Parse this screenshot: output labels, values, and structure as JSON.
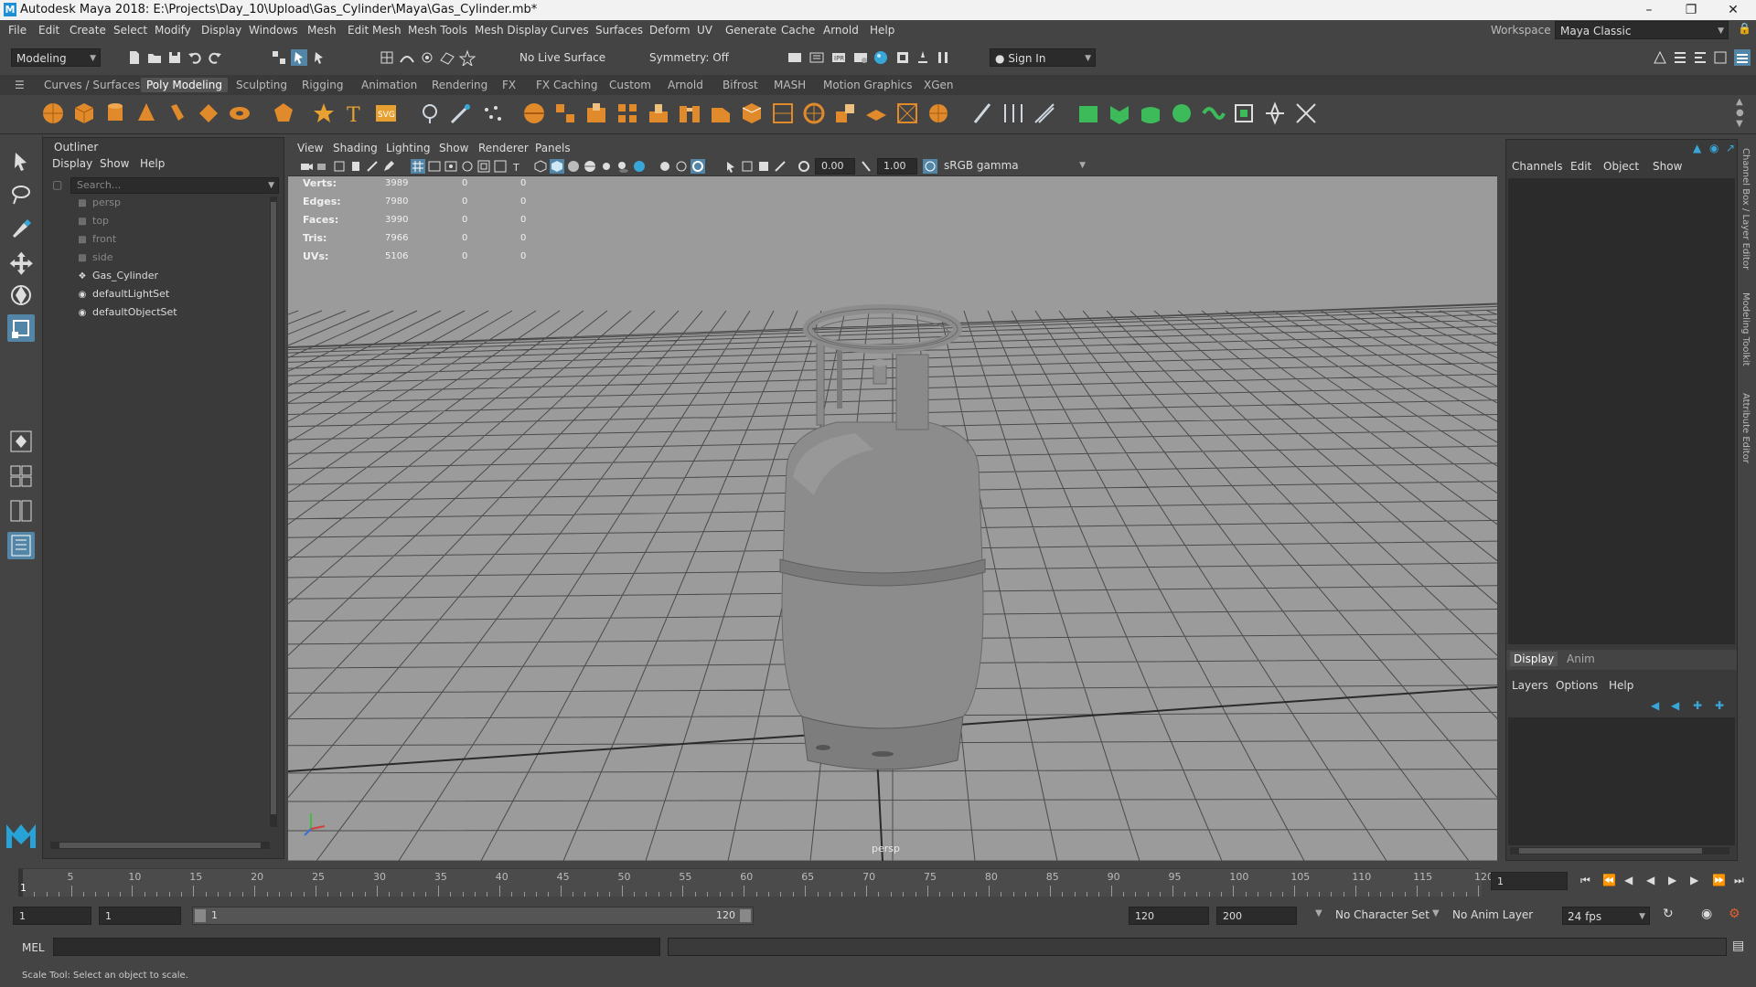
{
  "window": {
    "title": "Autodesk Maya 2018: E:\\Projects\\Day_10\\Upload\\Gas_Cylinder\\Maya\\Gas_Cylinder.mb*"
  },
  "menubar": {
    "items": [
      "File",
      "Edit",
      "Create",
      "Select",
      "Modify",
      "Display",
      "Windows",
      "Mesh",
      "Edit Mesh",
      "Mesh Tools",
      "Mesh Display",
      "Curves",
      "Surfaces",
      "Deform",
      "UV",
      "Generate",
      "Cache",
      "Arnold",
      "Help"
    ],
    "workspace_label": "Workspace :",
    "workspace_value": "Maya Classic"
  },
  "statusline": {
    "mode": "Modeling",
    "live_surface": "No Live Surface",
    "symmetry": "Symmetry: Off",
    "sign_in": "Sign In"
  },
  "shelf": {
    "tabs": [
      "Curves / Surfaces",
      "Poly Modeling",
      "Sculpting",
      "Rigging",
      "Animation",
      "Rendering",
      "FX",
      "FX Caching",
      "Custom",
      "Arnold",
      "Bifrost",
      "MASH",
      "Motion Graphics",
      "XGen"
    ],
    "active_tab": "Poly Modeling"
  },
  "outliner": {
    "title": "Outliner",
    "menus": [
      "Display",
      "Show",
      "Help"
    ],
    "search_placeholder": "Search...",
    "items": [
      {
        "label": "persp",
        "type": "camera"
      },
      {
        "label": "top",
        "type": "camera"
      },
      {
        "label": "front",
        "type": "camera"
      },
      {
        "label": "side",
        "type": "camera"
      },
      {
        "label": "Gas_Cylinder",
        "type": "transform"
      },
      {
        "label": "defaultLightSet",
        "type": "set"
      },
      {
        "label": "defaultObjectSet",
        "type": "set"
      }
    ]
  },
  "viewport": {
    "menus": [
      "View",
      "Shading",
      "Lighting",
      "Show",
      "Renderer",
      "Panels"
    ],
    "exposure": "0.00",
    "gamma": "1.00",
    "color_space": "sRGB gamma",
    "hud": [
      {
        "label": "Verts:",
        "v1": "3989",
        "v2": "0",
        "v3": "0"
      },
      {
        "label": "Edges:",
        "v1": "7980",
        "v2": "0",
        "v3": "0"
      },
      {
        "label": "Faces:",
        "v1": "3990",
        "v2": "0",
        "v3": "0"
      },
      {
        "label": "Tris:",
        "v1": "7966",
        "v2": "0",
        "v3": "0"
      },
      {
        "label": "UVs:",
        "v1": "5106",
        "v2": "0",
        "v3": "0"
      }
    ],
    "camera_label": "persp"
  },
  "channelbox": {
    "menus": [
      "Channels",
      "Edit",
      "Object",
      "Show"
    ],
    "layer_tabs": [
      "Display",
      "Anim"
    ],
    "layer_menus": [
      "Layers",
      "Options",
      "Help"
    ]
  },
  "side_tabs": [
    "Channel Box / Layer Editor",
    "Modeling Toolkit",
    "Attribute Editor"
  ],
  "timeslider": {
    "ticks": [
      "5",
      "10",
      "15",
      "20",
      "25",
      "30",
      "35",
      "40",
      "45",
      "50",
      "55",
      "60",
      "65",
      "70",
      "75",
      "80",
      "85",
      "90",
      "95",
      "100",
      "105",
      "110",
      "115",
      "120"
    ],
    "current_frame_marker": "1",
    "current_frame": "1"
  },
  "rangeslider": {
    "start": "1",
    "playback_start": "1",
    "range_start": "1",
    "range_end": "120",
    "playback_end": "120",
    "end": "200",
    "character_set": "No Character Set",
    "anim_layer": "No Anim Layer",
    "fps": "24 fps"
  },
  "cmdline": {
    "label": "MEL"
  },
  "helpline": {
    "text": "Scale Tool: Select an object to scale."
  },
  "colors": {
    "accent": "#5285a6",
    "viewport_bg": "#9b9b9b",
    "panel": "#444444"
  }
}
